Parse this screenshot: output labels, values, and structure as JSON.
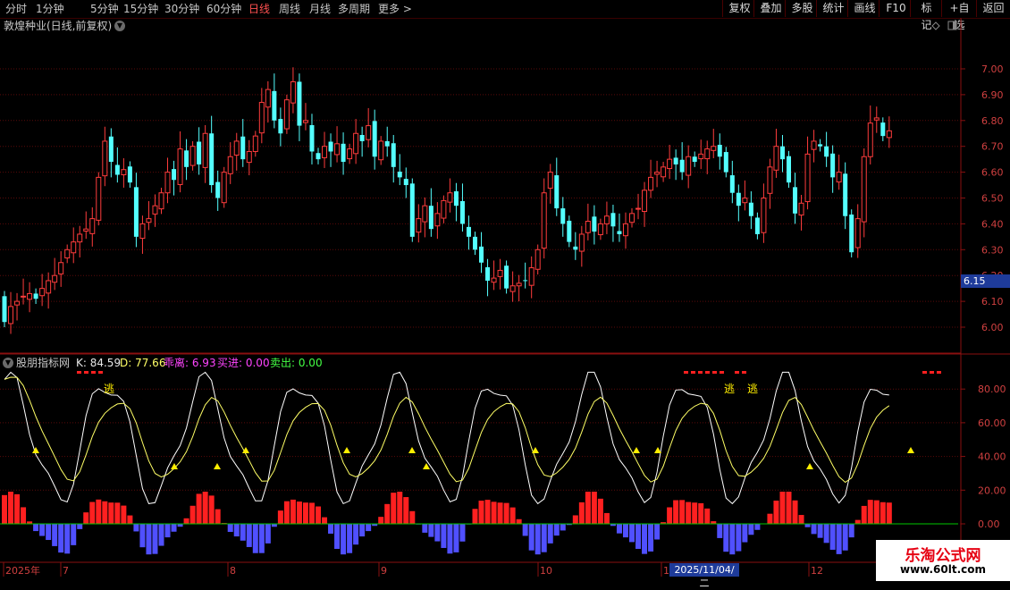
{
  "toolbar": {
    "timeframes": [
      "分时",
      "1分钟",
      "5分钟",
      "15分钟",
      "30分钟",
      "60分钟",
      "日线",
      "周线",
      "月线",
      "多周期",
      "更多 >"
    ],
    "active_timeframe": "日线",
    "right_buttons": [
      "复权",
      "叠加",
      "多股",
      "统计",
      "画线",
      "F10",
      "标记",
      "+自选",
      "返回"
    ]
  },
  "main_chart": {
    "title": "敦煌种业(日线,前复权)",
    "price_axis": [
      "7.00",
      "6.90",
      "6.80",
      "6.70",
      "6.60",
      "6.50",
      "6.40",
      "6.30",
      "6.20",
      "6.10",
      "6.00"
    ],
    "current_price_tag": "6.15"
  },
  "indicator": {
    "name": "股朋指标网",
    "k_label": "K: 84.59",
    "d_label": "D: 77.66",
    "divergence_label": "乖离: 6.93",
    "buy_label": "买进: 0.00",
    "sell_label": "卖出: 0.00",
    "axis": [
      "80.00",
      "60.00",
      "40.00",
      "20.00",
      "0.00"
    ],
    "escape_label": "逃"
  },
  "date_axis": {
    "labels": [
      "2025年",
      "7",
      "8",
      "9",
      "10",
      "1",
      "12"
    ],
    "cursor_date": "2025/11/04/二"
  },
  "watermark": {
    "title": "乐淘公式网",
    "url": "www.60lt.com"
  },
  "colors": {
    "up": "#ff3c3c",
    "down": "#54ffff",
    "k_line": "#ffffff",
    "d_line": "#ffff66",
    "hist_up": "#ff2020",
    "hist_down": "#5050ff",
    "zero_line": "#00c800",
    "signal": "#ffee00",
    "grid_axis": "#8a1010"
  }
}
